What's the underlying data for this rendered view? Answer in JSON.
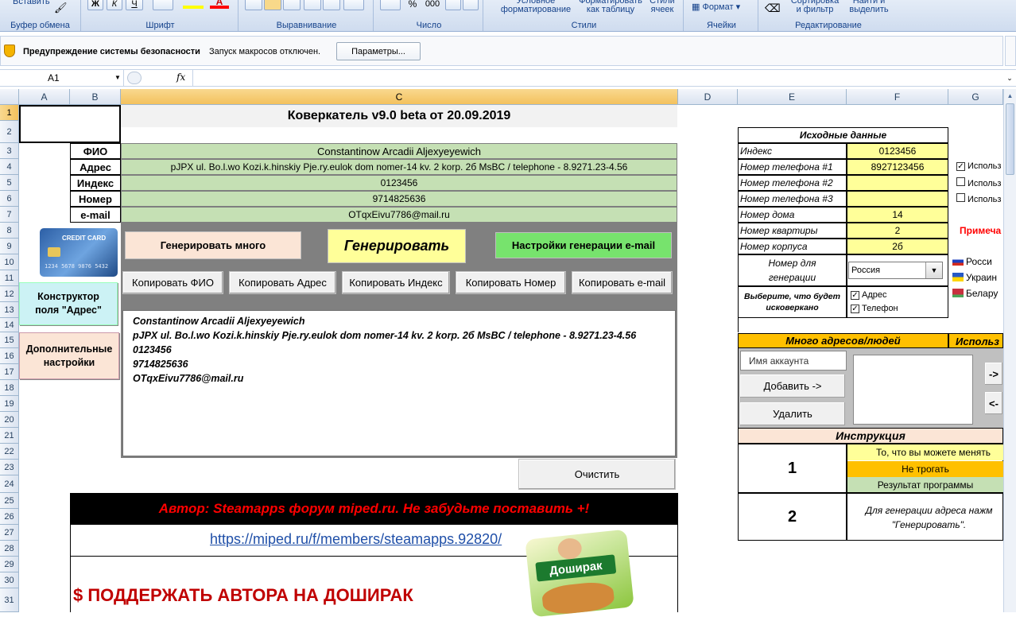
{
  "ribbon": {
    "insert_label": "Вставить",
    "groups": [
      "Буфер обмена",
      "Шрифт",
      "Выравнивание",
      "Число",
      "Стили",
      "Ячейки",
      "Редактирование"
    ],
    "bold": "Ж",
    "italic": "К",
    "underline": "Ч",
    "percent": "%",
    "thousands": "000",
    "cond_format": "Условное\nформатирование",
    "format_table": "Форматировать\nкак таблицу",
    "cell_styles": "Стили\nячеек",
    "format": "Формат",
    "sort_filter": "Сортировка\nи фильтр",
    "find_select": "Найти и\nвыделить"
  },
  "security": {
    "title": "Предупреждение системы безопасности",
    "message": "Запуск макросов отключен.",
    "button": "Параметры..."
  },
  "formula_bar": {
    "name_box": "A1",
    "fx": "fx",
    "value": ""
  },
  "columns": [
    "A",
    "B",
    "C",
    "D",
    "E",
    "F",
    "G"
  ],
  "rows": [
    "1",
    "2",
    "3",
    "4",
    "5",
    "6",
    "7",
    "8",
    "9",
    "10",
    "11",
    "12",
    "13",
    "14",
    "15",
    "16",
    "17",
    "18",
    "19",
    "20",
    "21",
    "22",
    "23",
    "24",
    "25",
    "26",
    "27",
    "28",
    "29",
    "30",
    "31"
  ],
  "sheet": {
    "title": "Коверкатель v9.0 beta от 20.09.2019",
    "fields": [
      {
        "label": "ФИО",
        "value": "Constantinow Arcadii Aljexyeyewich"
      },
      {
        "label": "Адрес",
        "value": "pJPX ul. Bo.l.wo  Kozi.k.hinskiy  Pje.ry.eulok dom nomer-14 kv. 2 korp. 2б MsBC  / telephone - 8.9271.23-4.56"
      },
      {
        "label": "Индекс",
        "value": "0123456"
      },
      {
        "label": "Номер",
        "value": "9714825636"
      },
      {
        "label": "e-mail",
        "value": "OTqxEivu7786@mail.ru"
      }
    ],
    "card_text": "CREDIT CARD",
    "card_number": "1234 5678 9876 5432",
    "btn_generate_many": "Генерировать много",
    "btn_generate": "Генерировать",
    "btn_email_settings": "Настройки генерации e-mail",
    "copy_buttons": [
      "Копировать ФИО",
      "Копировать Адрес",
      "Копировать Индекс",
      "Копировать Номер",
      "Копировать e-mail"
    ],
    "btn_constructor": "Конструктор\nполя \"Адрес\"",
    "btn_extra": "Дополнительные\nнастройки",
    "output_lines": [
      "Constantinow Arcadii Aljexyeyewich",
      "pJPX ul. Bo.l.wo  Kozi.k.hinskiy  Pje.ry.eulok dom nomer-14 kv. 2 korp. 2б MsBC  / telephone - 8.9271.23-4.56",
      "0123456",
      "9714825636",
      "OTqxEivu7786@mail.ru"
    ],
    "btn_clear": "Очистить",
    "author": "Автор: Steamapps форум miped.ru. Не забудьте поставить +!",
    "link": "https://miped.ru/f/members/steamapps.92820/",
    "donate": "$ ПОДДЕРЖАТЬ АВТОРА НА ДОШИРАК",
    "doshirak": "Доширак"
  },
  "source": {
    "header": "Исходные данные",
    "rows": [
      {
        "label": "Индекс",
        "value": "0123456"
      },
      {
        "label": "Номер телефона #1",
        "value": "8927123456"
      },
      {
        "label": "Номер телефона #2",
        "value": ""
      },
      {
        "label": "Номер телефона #3",
        "value": ""
      },
      {
        "label": "Номер дома",
        "value": "14"
      },
      {
        "label": "Номер квартиры",
        "value": "2"
      },
      {
        "label": "Номер корпуса",
        "value": "2б"
      }
    ],
    "use_labels": [
      "Использ",
      "Использ",
      "Использ"
    ],
    "note": "Примеча",
    "num_for_gen": "Номер для\nгенерации",
    "country_select": "Россия",
    "countries": [
      "Росси",
      "Украин",
      "Белару"
    ],
    "choose": "Выберите, что будет исковеркано",
    "opt_address": "Адрес",
    "opt_phone": "Телефон",
    "many_header": "Много адресов/людей",
    "used_header": "Использ",
    "account_placeholder": "Имя аккаунта",
    "btn_add": "Добавить ->",
    "btn_delete": "Удалить",
    "arrow_right": "->",
    "arrow_left": "<-",
    "instr_header": "Инструкция",
    "instr1_num": "1",
    "legend": [
      "То, что вы можете менять",
      "Не трогать",
      "Результат программы"
    ],
    "instr2_num": "2",
    "instr2_text": "Для генерации адреса нажм\n\"Генерировать\"."
  },
  "colors": {
    "green": "#c5e0b4",
    "yellow": "#ffff99",
    "orange": "#ffc000",
    "peach": "#fbe5d6",
    "author_red": "#ff0000",
    "donate_red": "#c00000"
  }
}
